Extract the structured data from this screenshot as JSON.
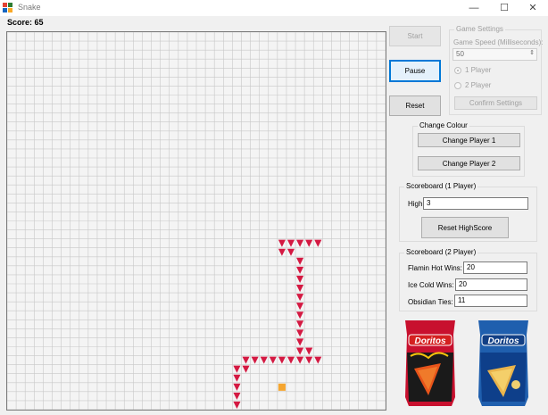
{
  "window": {
    "title": "Snake",
    "minimize": "—",
    "maximize": "☐",
    "close": "✕"
  },
  "score": "Score: 65",
  "game": {
    "cols": 42,
    "rows": 42,
    "snake_color": "#d41942",
    "food_color": "#f5a52f",
    "food_cell": [
      30,
      39
    ],
    "snake_cells": [
      [
        30,
        23
      ],
      [
        31,
        23
      ],
      [
        32,
        23
      ],
      [
        33,
        23
      ],
      [
        34,
        23
      ],
      [
        30,
        24
      ],
      [
        31,
        24
      ],
      [
        32,
        25
      ],
      [
        32,
        26
      ],
      [
        32,
        27
      ],
      [
        32,
        28
      ],
      [
        32,
        29
      ],
      [
        32,
        30
      ],
      [
        32,
        31
      ],
      [
        32,
        32
      ],
      [
        32,
        33
      ],
      [
        32,
        34
      ],
      [
        32,
        35
      ],
      [
        33,
        35
      ],
      [
        26,
        36
      ],
      [
        27,
        36
      ],
      [
        28,
        36
      ],
      [
        29,
        36
      ],
      [
        30,
        36
      ],
      [
        31,
        36
      ],
      [
        32,
        36
      ],
      [
        33,
        36
      ],
      [
        34,
        36
      ],
      [
        25,
        37
      ],
      [
        26,
        37
      ],
      [
        25,
        38
      ],
      [
        25,
        39
      ],
      [
        25,
        40
      ],
      [
        25,
        41
      ]
    ]
  },
  "controls": {
    "start": "Start",
    "pause": "Pause",
    "reset": "Reset"
  },
  "settings": {
    "title": "Game Settings",
    "speed_label": "Game Speed (Milliseconds):",
    "speed_value": "50",
    "one_player": "1 Player",
    "two_player": "2 Player",
    "confirm": "Confirm Settings"
  },
  "colour": {
    "title": "Change Colour",
    "p1": "Change Player 1",
    "p2": "Change Player 2"
  },
  "scoreboard1": {
    "title": "Scoreboard (1 Player)",
    "high_label": "HighScore:",
    "high_value": "3",
    "reset": "Reset HighScore"
  },
  "scoreboard2": {
    "title": "Scoreboard (2 Player)",
    "flamin_label": "Flamin Hot Wins:",
    "flamin_value": "20",
    "ice_label": "Ice Cold Wins:",
    "ice_value": "20",
    "ties_label": "Obsidian Ties:",
    "ties_value": "11"
  },
  "bags": {
    "brand": "Doritos",
    "left_color": "#c8102e",
    "right_color": "#1f5fae"
  }
}
